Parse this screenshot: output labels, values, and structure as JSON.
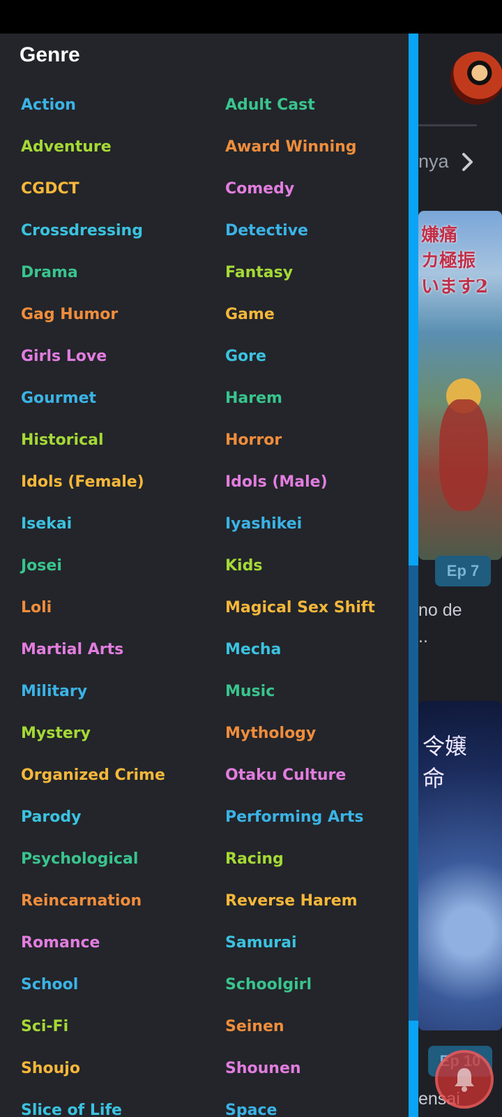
{
  "background": {
    "tab_text": "nya",
    "poster1_text": "嫌痛\nカ極振\nいます2",
    "poster2_text": "令嬢\n命",
    "episode_badges": [
      "Ep 7",
      "Ep 10"
    ],
    "titles": [
      "no de",
      "..",
      "ensai"
    ]
  },
  "drawer": {
    "title": "Genre",
    "genres": [
      {
        "label": "Action",
        "color": "#3bb3e6"
      },
      {
        "label": "Adult Cast",
        "color": "#39c48e"
      },
      {
        "label": "Adventure",
        "color": "#a5d935"
      },
      {
        "label": "Award Winning",
        "color": "#f08d3c"
      },
      {
        "label": "CGDCT",
        "color": "#f5b73a"
      },
      {
        "label": "Comedy",
        "color": "#e27ddf"
      },
      {
        "label": "Crossdressing",
        "color": "#3bc2e0"
      },
      {
        "label": "Detective",
        "color": "#3bb3e6"
      },
      {
        "label": "Drama",
        "color": "#39c48e"
      },
      {
        "label": "Fantasy",
        "color": "#a5d935"
      },
      {
        "label": "Gag Humor",
        "color": "#f08d3c"
      },
      {
        "label": "Game",
        "color": "#f5b73a"
      },
      {
        "label": "Girls Love",
        "color": "#e27ddf"
      },
      {
        "label": "Gore",
        "color": "#3bc2e0"
      },
      {
        "label": "Gourmet",
        "color": "#3bb3e6"
      },
      {
        "label": "Harem",
        "color": "#39c48e"
      },
      {
        "label": "Historical",
        "color": "#a5d935"
      },
      {
        "label": "Horror",
        "color": "#f08d3c"
      },
      {
        "label": "Idols (Female)",
        "color": "#f5b73a"
      },
      {
        "label": "Idols (Male)",
        "color": "#e27ddf"
      },
      {
        "label": "Isekai",
        "color": "#3bc2e0"
      },
      {
        "label": "Iyashikei",
        "color": "#3bb3e6"
      },
      {
        "label": "Josei",
        "color": "#39c48e"
      },
      {
        "label": "Kids",
        "color": "#a5d935"
      },
      {
        "label": "Loli",
        "color": "#f08d3c"
      },
      {
        "label": "Magical Sex Shift",
        "color": "#f5b73a"
      },
      {
        "label": "Martial Arts",
        "color": "#e27ddf"
      },
      {
        "label": "Mecha",
        "color": "#3bc2e0"
      },
      {
        "label": "Military",
        "color": "#3bb3e6"
      },
      {
        "label": "Music",
        "color": "#39c48e"
      },
      {
        "label": "Mystery",
        "color": "#a5d935"
      },
      {
        "label": "Mythology",
        "color": "#f08d3c"
      },
      {
        "label": "Organized Crime",
        "color": "#f5b73a"
      },
      {
        "label": "Otaku Culture",
        "color": "#e27ddf"
      },
      {
        "label": "Parody",
        "color": "#3bc2e0"
      },
      {
        "label": "Performing Arts",
        "color": "#3bb3e6"
      },
      {
        "label": "Psychological",
        "color": "#39c48e"
      },
      {
        "label": "Racing",
        "color": "#a5d935"
      },
      {
        "label": "Reincarnation",
        "color": "#f08d3c"
      },
      {
        "label": "Reverse Harem",
        "color": "#f5b73a"
      },
      {
        "label": "Romance",
        "color": "#e27ddf"
      },
      {
        "label": "Samurai",
        "color": "#3bc2e0"
      },
      {
        "label": "School",
        "color": "#3bb3e6"
      },
      {
        "label": "Schoolgirl",
        "color": "#39c48e"
      },
      {
        "label": "Sci-Fi",
        "color": "#a5d935"
      },
      {
        "label": "Seinen",
        "color": "#f08d3c"
      },
      {
        "label": "Shoujo",
        "color": "#f5b73a"
      },
      {
        "label": "Shounen",
        "color": "#e27ddf"
      },
      {
        "label": "Slice of Life",
        "color": "#3bc2e0"
      },
      {
        "label": "Space",
        "color": "#3bb3e6"
      }
    ]
  }
}
